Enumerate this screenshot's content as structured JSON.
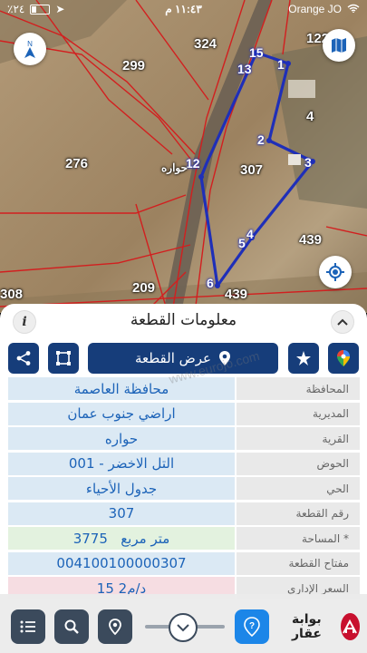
{
  "status_bar": {
    "battery_text": "٪٢٤",
    "time": "١١:٤٣ م",
    "carrier": "Orange JO"
  },
  "map": {
    "parcel_labels": [
      "324",
      "122",
      "299",
      "276",
      "307",
      "4",
      "439",
      "308",
      "209",
      "439"
    ],
    "vertex_labels": [
      "15",
      "13",
      "1",
      "2",
      "3",
      "12",
      "5",
      "4",
      "6"
    ],
    "place_label": "حواره",
    "boundary_color": "#1f2fb8",
    "road_color": "#d21f1f"
  },
  "panel": {
    "title": "معلومات القطعة",
    "show_button_label": "عرض القطعة",
    "watermark": "www.eurojo.com",
    "rows": [
      {
        "label": "المحافظة",
        "value": "محافظة العاصمة",
        "tone": "blue"
      },
      {
        "label": "المديرية",
        "value": "اراضي جنوب عمان",
        "tone": "blue"
      },
      {
        "label": "القرية",
        "value": "حواره",
        "tone": "blue"
      },
      {
        "label": "الحوض",
        "value": "التل الاخضر - 001",
        "tone": "blue"
      },
      {
        "label": "الحي",
        "value": "جدول الأحياء",
        "tone": "blue"
      },
      {
        "label": "رقم القطعة",
        "value": "307",
        "tone": "blue"
      },
      {
        "label": "المساحة *",
        "value": "3775   متر مربع",
        "tone": "green"
      },
      {
        "label": "مفتاح القطعة",
        "value": "004100100000307",
        "tone": "blue"
      },
      {
        "label": "السعر الإداري",
        "value": "15 د/م2",
        "tone": "pink"
      }
    ]
  },
  "bottom_bar": {
    "logo_text": "بوابة عقار",
    "accent": "#1c86e8"
  }
}
